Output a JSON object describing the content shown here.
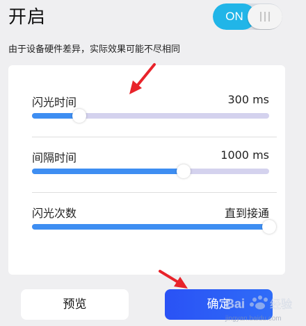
{
  "header": {
    "title": "开启",
    "toggle_label": "ON",
    "toggle_state": "on"
  },
  "subtitle": "由于设备硬件差异，实际效果可能不尽相同",
  "settings": [
    {
      "label": "闪光时间",
      "value": "300 ms",
      "level": 0.2
    },
    {
      "label": "间隔时间",
      "value": "1000 ms",
      "level": 0.64
    },
    {
      "label": "闪光次数",
      "value": "直到接通",
      "level": 1.0
    }
  ],
  "buttons": {
    "preview": "预览",
    "confirm": "确定"
  },
  "watermark": {
    "brand": "Baidu经验",
    "url": "jingyan.baidu.com"
  },
  "colors": {
    "toggle_on": "#21b5e8",
    "slider_fill": "#3e8ef2",
    "slider_track": "#d4d2ee",
    "confirm_button": "#2a52f5",
    "annotation_arrow": "#e8232a"
  }
}
